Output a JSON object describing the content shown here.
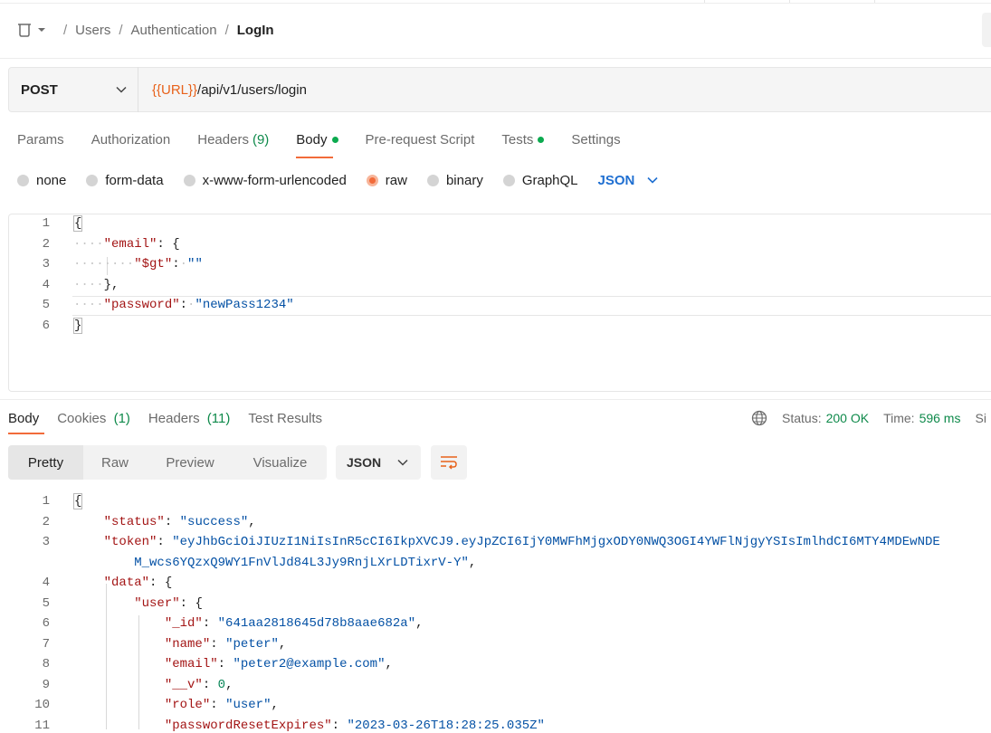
{
  "breadcrumb": {
    "items": [
      "Users",
      "Authentication"
    ],
    "current": "LogIn",
    "separator": "/"
  },
  "request": {
    "method": "POST",
    "url_var": "{{URL}}",
    "url_path": "/api/v1/users/login"
  },
  "request_tabs": {
    "params": "Params",
    "authorization": "Authorization",
    "headers": "Headers",
    "headers_count": "(9)",
    "body": "Body",
    "prerequest": "Pre-request Script",
    "tests": "Tests",
    "settings": "Settings",
    "active": "Body"
  },
  "body_types": {
    "none": "none",
    "form_data": "form-data",
    "urlencoded": "x-www-form-urlencoded",
    "raw": "raw",
    "binary": "binary",
    "graphql": "GraphQL",
    "selected": "raw",
    "language": "JSON"
  },
  "request_body": {
    "line_numbers": [
      "1",
      "2",
      "3",
      "4",
      "5",
      "6"
    ],
    "lines": {
      "l1": "{",
      "l2_key": "\"email\"",
      "l2_rest": ": {",
      "l3_key": "\"$gt\"",
      "l3_val": "\"\"",
      "l4": "},",
      "l5_key": "\"password\"",
      "l5_val": "\"newPass1234\"",
      "l6": "}"
    }
  },
  "response_tabs": {
    "body": "Body",
    "cookies": "Cookies",
    "cookies_count": "(1)",
    "headers": "Headers",
    "headers_count": "(11)",
    "test_results": "Test Results",
    "active": "Body"
  },
  "response_status": {
    "status_label": "Status:",
    "status_value": "200 OK",
    "time_label": "Time:",
    "time_value": "596 ms",
    "size_label": "Si"
  },
  "view_modes": {
    "pretty": "Pretty",
    "raw": "Raw",
    "preview": "Preview",
    "visualize": "Visualize",
    "selected": "Pretty",
    "format": "JSON"
  },
  "response_body": {
    "line_numbers": [
      "1",
      "2",
      "3",
      "",
      "4",
      "5",
      "6",
      "7",
      "8",
      "9",
      "10",
      "11"
    ],
    "lines": {
      "l1": "{",
      "status_key": "\"status\"",
      "status_val": "\"success\"",
      "token_key": "\"token\"",
      "token_val_1": "\"eyJhbGciOiJIUzI1NiIsInR5cCI6IkpXVCJ9.eyJpZCI6IjY0MWFhMjgxODY0NWQ3OGI4YWFlNjgyYSIsImlhdCI6MTY4MDEwNDE",
      "token_val_2": "M_wcs6YQzxQ9WY1FnVlJd84L3Jy9RnjLXrLDTixrV-Y\"",
      "data_key": "\"data\"",
      "user_key": "\"user\"",
      "id_key": "\"_id\"",
      "id_val": "\"641aa2818645d78b8aae682a\"",
      "name_key": "\"name\"",
      "name_val": "\"peter\"",
      "email_key": "\"email\"",
      "email_val": "\"peter2@example.com\"",
      "v_key": "\"__v\"",
      "v_val": "0",
      "role_key": "\"role\"",
      "role_val": "\"user\"",
      "pre_key": "\"passwordResetExpires\"",
      "pre_val": "\"2023-03-26T18:28:25.035Z\""
    }
  },
  "colors": {
    "accent": "#f26b3a",
    "variable": "#e8621b",
    "success": "#0f8a4b",
    "json_key": "#a31515",
    "json_string": "#0451a5",
    "link_blue": "#1f6fd1"
  }
}
